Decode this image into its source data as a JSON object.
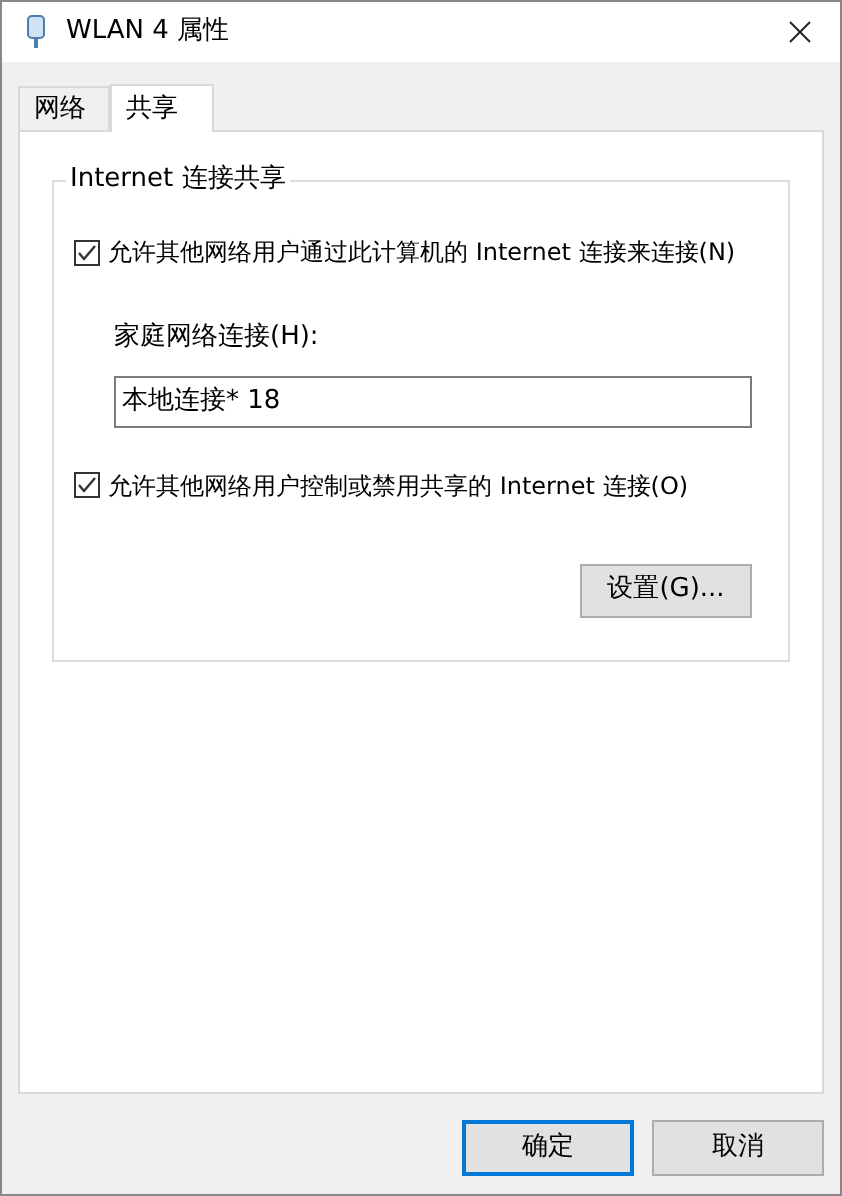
{
  "window": {
    "title": "WLAN 4 属性"
  },
  "tabs": [
    {
      "label": "网络",
      "selected": false
    },
    {
      "label": "共享",
      "selected": true
    }
  ],
  "group": {
    "title": "Internet 连接共享",
    "allow_sharing": {
      "label": "允许其他网络用户通过此计算机的 Internet 连接来连接(N)",
      "checked": true
    },
    "home_network": {
      "label": "家庭网络连接(H):",
      "value": "本地连接* 18"
    },
    "allow_control": {
      "label": "允许其他网络用户控制或禁用共享的 Internet 连接(O)",
      "checked": true
    },
    "settings_button": "设置(G)..."
  },
  "buttons": [
    {
      "label": "确定",
      "selected": true
    },
    {
      "label": "取消",
      "selected": false
    }
  ]
}
